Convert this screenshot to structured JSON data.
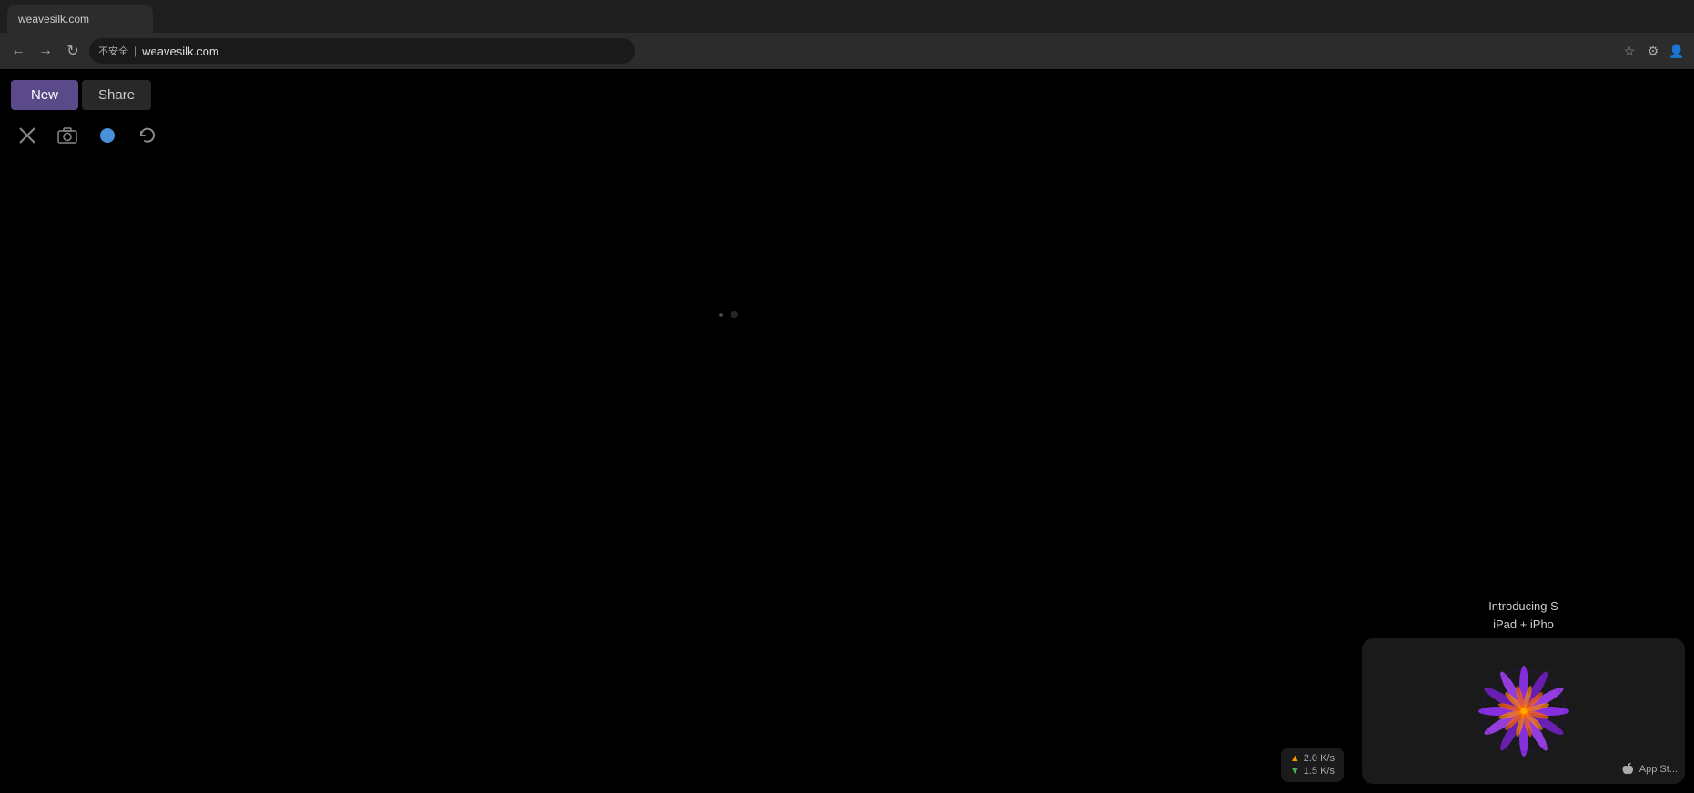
{
  "browser": {
    "url": "weavesilk.com",
    "security_label": "不安全",
    "tab_title": "weavesilk.com"
  },
  "toolbar": {
    "new_label": "New",
    "share_label": "Share"
  },
  "icons": {
    "expand": "✕",
    "camera": "📷",
    "circle": "●",
    "refresh": "↺"
  },
  "notification": {
    "title": "Introducing S",
    "subtitle": "iPad + iPho",
    "app_store_label": "App St..."
  },
  "network": {
    "download": "1.5 K/s",
    "upload": "2.0 K/s"
  }
}
